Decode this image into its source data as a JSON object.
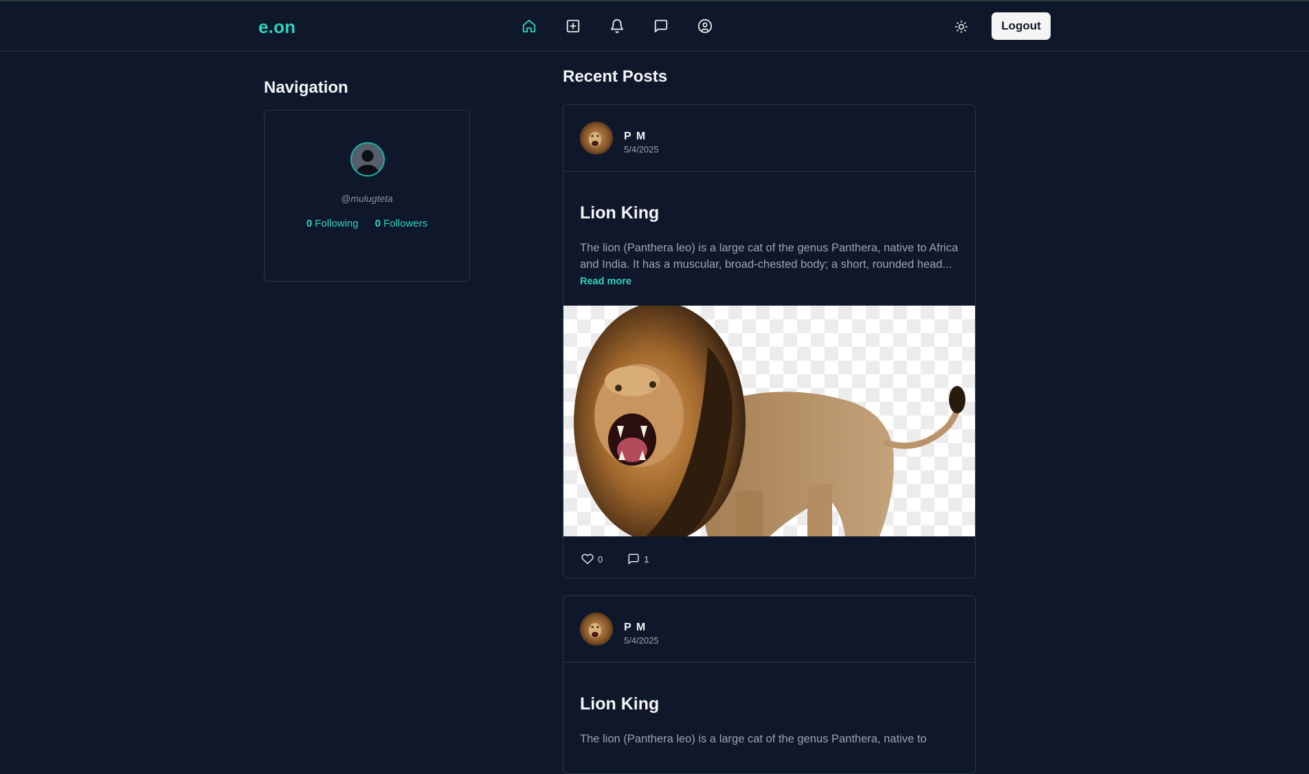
{
  "app": {
    "logo": "e.on"
  },
  "header": {
    "nav_icons": [
      "home-icon",
      "create-post-icon",
      "bell-icon",
      "message-icon",
      "profile-icon"
    ],
    "active_icon": "home-icon",
    "theme_icon": "sun-icon",
    "logout_label": "Logout"
  },
  "sidebar": {
    "title": "Navigation",
    "profile": {
      "handle": "@mulugteta",
      "following_count": "0",
      "following_label": "Following",
      "followers_count": "0",
      "followers_label": "Followers"
    }
  },
  "feed": {
    "title": "Recent Posts",
    "posts": [
      {
        "author": "P M",
        "date": "5/4/2025",
        "title": "Lion King",
        "excerpt": "The lion (Panthera leo) is a large cat of the genus Panthera, native to Africa and India. It has a muscular, broad-chested body; a short, rounded head...",
        "read_more": "Read more",
        "likes": "0",
        "comments": "1"
      },
      {
        "author": "P M",
        "date": "5/4/2025",
        "title": "Lion King",
        "excerpt": "The lion (Panthera leo) is a large cat of the genus Panthera, native to"
      }
    ]
  },
  "colors": {
    "accent": "#2dd4bf",
    "background": "#0f172a",
    "border": "#2a3547"
  }
}
